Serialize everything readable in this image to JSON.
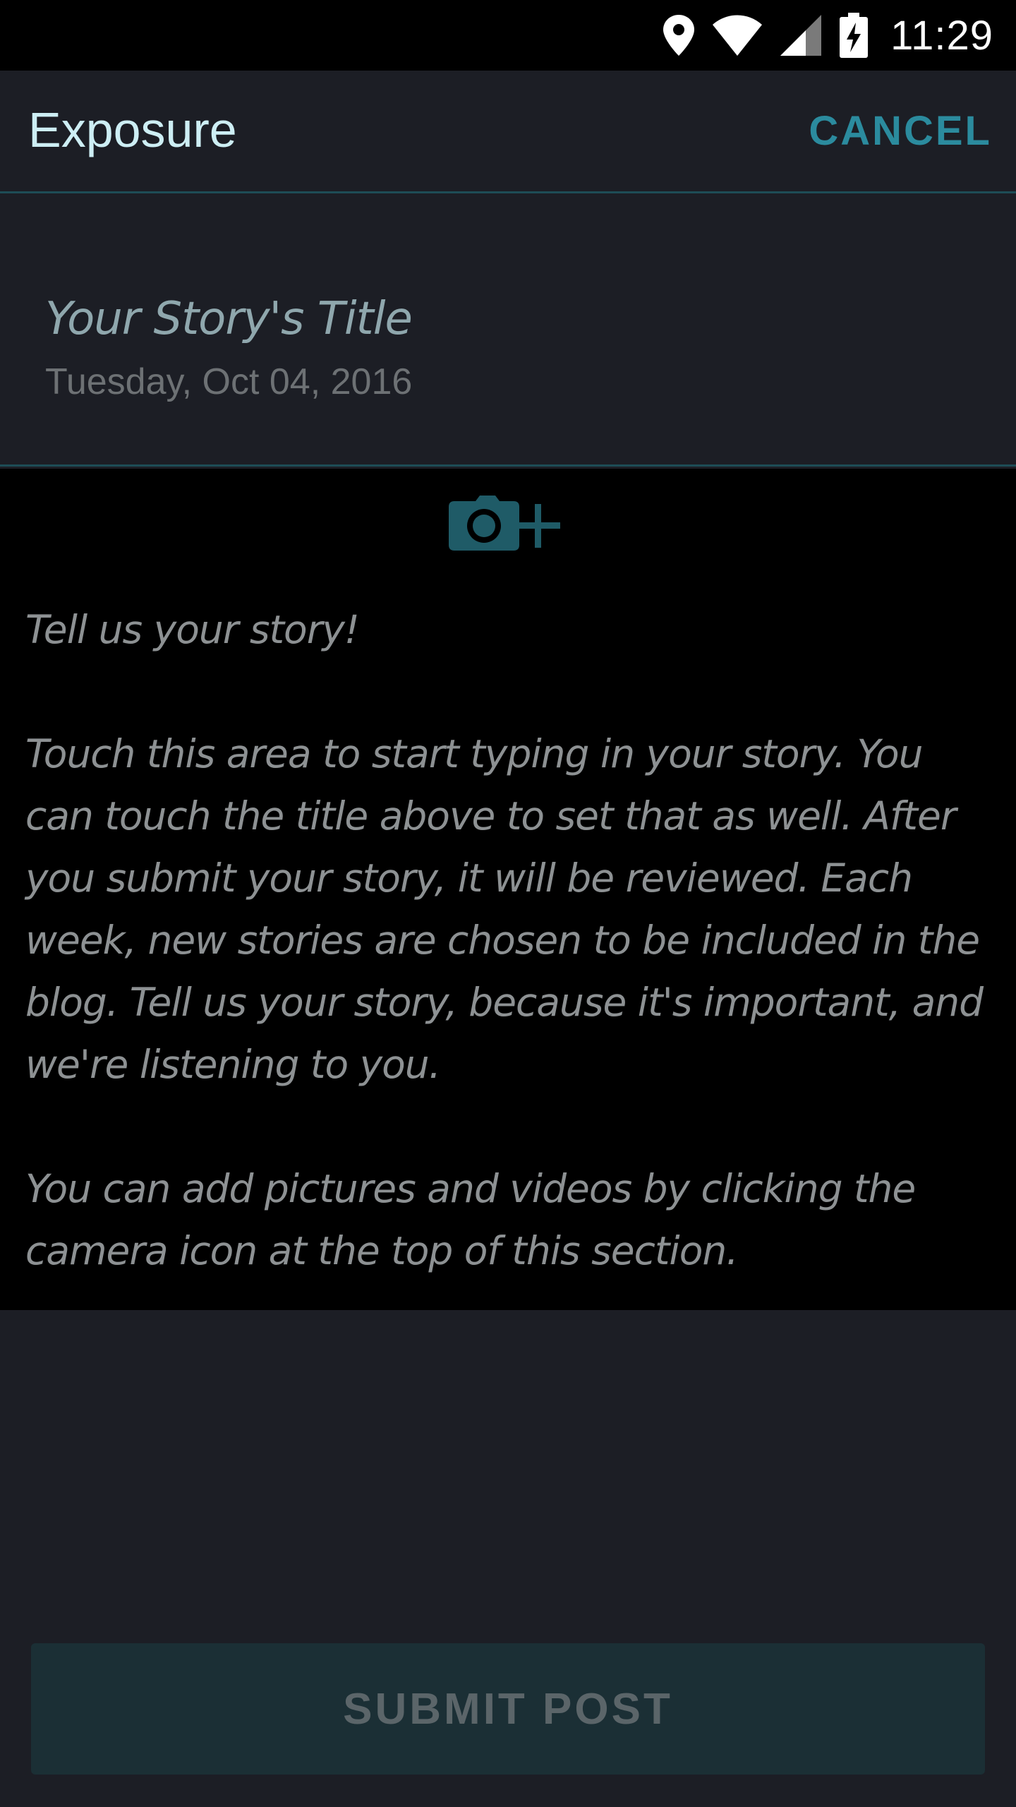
{
  "status_bar": {
    "time": "11:29",
    "icons": [
      "location-icon",
      "wifi-icon",
      "signal-icon",
      "battery-charging-icon"
    ]
  },
  "app_bar": {
    "title": "Exposure",
    "cancel_label": "CANCEL"
  },
  "story": {
    "title_placeholder": "Your Story's Title",
    "date": "Tuesday, Oct 04, 2016",
    "add_media_icon": "camera-add-icon",
    "body_paragraphs": [
      "Tell us your story!",
      "Touch this area to start typing in your story. You can touch the title above to set that as well. After you submit your story, it will be reviewed. Each week, new stories are chosen to be included in the blog. Tell us your story, because it's important, and we're listening to you.",
      "You can add pictures and videos by clicking the camera icon at the top of this section."
    ]
  },
  "footer": {
    "submit_label": "SUBMIT POST"
  },
  "colors": {
    "background": "#1c1e25",
    "accent": "#2b8b9e",
    "divider": "#1e4d56",
    "icon_teal": "#1f5b67"
  }
}
